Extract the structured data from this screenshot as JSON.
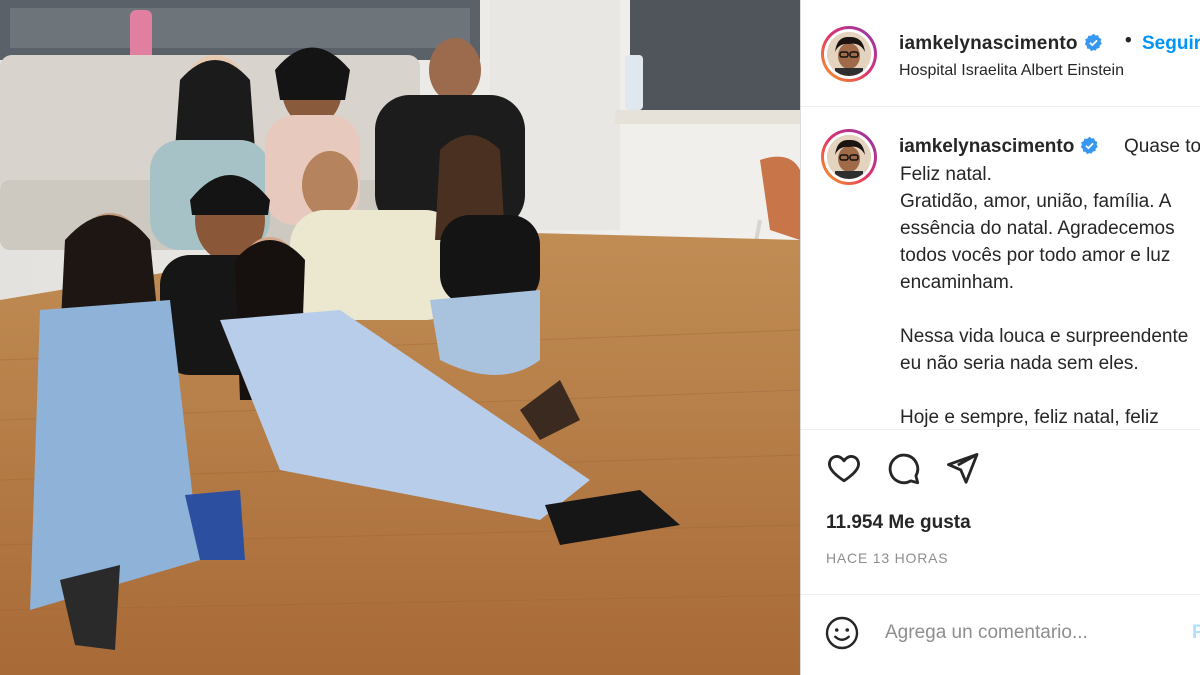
{
  "post": {
    "username": "iamkelynascimento",
    "verified": true,
    "separator": "•",
    "follow_label": "Seguir",
    "location": "Hospital Israelita Albert Einstein",
    "caption_first": "Quase todos",
    "caption_lines": [
      "Feliz natal.",
      "Gratidão, amor, união, família. A",
      "essência do natal. Agradecemos",
      "todos vocês por todo amor e luz",
      "encaminham."
    ],
    "caption_para2": [
      "Nessa vida louca e surpreendente",
      "eu não seria nada sem eles."
    ],
    "caption_para3": "Hoje e sempre, feliz natal, feliz",
    "likes": "11.954 Me gusta",
    "timestamp": "HACE 13 HORAS",
    "comment_placeholder": "Agrega un comentario...",
    "publish_label": "Publicar"
  },
  "icons": {
    "like": "heart-icon",
    "comment": "comment-icon",
    "share": "share-icon",
    "emoji": "emoji-icon",
    "verified": "verified-badge-icon"
  },
  "colors": {
    "accent": "#0095f6",
    "muted": "#8e8e8e",
    "text": "#262626",
    "publish_disabled": "#b2dffc"
  }
}
